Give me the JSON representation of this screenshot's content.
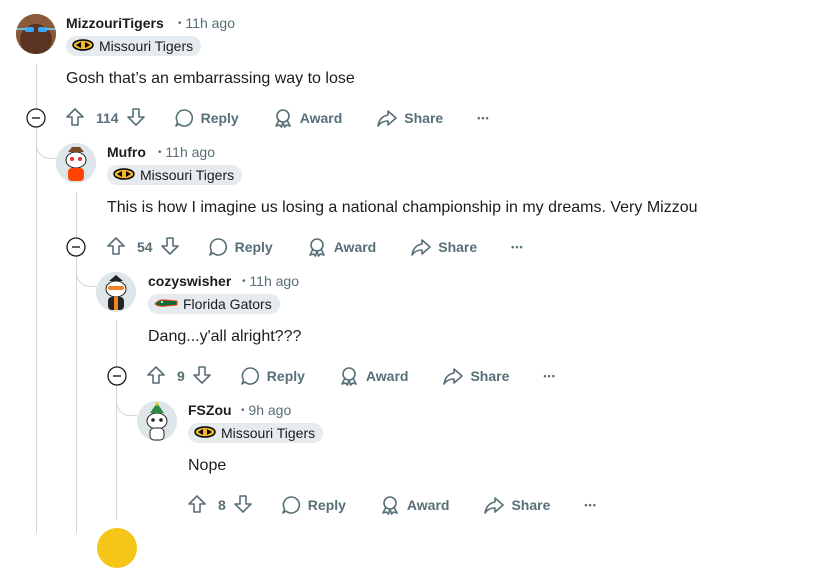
{
  "comments": [
    {
      "username": "MizzouriTigers",
      "time": "11h ago",
      "flair": "Missouri Tigers",
      "text": "Gosh that’s an embarrassing way to lose",
      "votes": "114",
      "actions": {
        "reply": "Reply",
        "award": "Award",
        "share": "Share"
      }
    },
    {
      "username": "Mufro",
      "time": "11h ago",
      "flair": "Missouri Tigers",
      "text": "This is how I imagine us losing a national championship in my dreams. Very Mizzou",
      "votes": "54",
      "actions": {
        "reply": "Reply",
        "award": "Award",
        "share": "Share"
      }
    },
    {
      "username": "cozyswisher",
      "time": "11h ago",
      "flair": "Florida Gators",
      "text": "Dang...y'all alright???",
      "votes": "9",
      "actions": {
        "reply": "Reply",
        "award": "Award",
        "share": "Share"
      }
    },
    {
      "username": "FSZou",
      "time": "9h ago",
      "flair": "Missouri Tigers",
      "text": "Nope",
      "votes": "8",
      "actions": {
        "reply": "Reply",
        "award": "Award",
        "share": "Share"
      }
    }
  ],
  "separator": "•",
  "more": "•••",
  "icons": {
    "upvote": "arrow-up-icon",
    "downvote": "arrow-down-icon",
    "reply": "speech-bubble-icon",
    "award": "award-ribbon-icon",
    "share": "share-arrow-icon",
    "collapse": "minus-circle-icon",
    "flair_missouri": "tiger-logo-icon",
    "flair_florida": "gator-logo-icon"
  },
  "colors": {
    "text": "#1c1c1c",
    "meta": "#576f76",
    "flair_bg": "#e5ebee",
    "thread_line": "#d4d6d8",
    "missouri_gold": "#f1b82d",
    "florida_green": "#0b6b3a",
    "florida_orange": "#fa4616"
  }
}
